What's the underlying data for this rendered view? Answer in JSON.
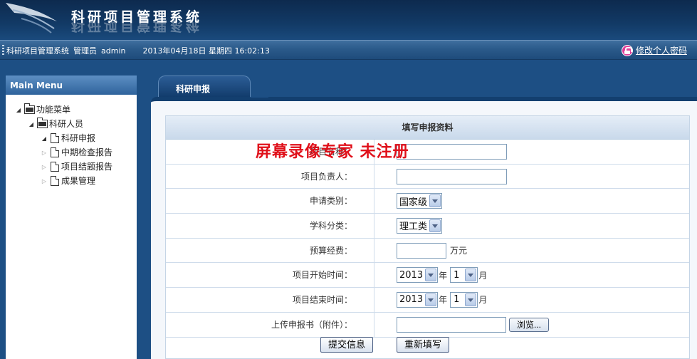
{
  "header": {
    "system_title": "科研项目管理系统"
  },
  "infobar": {
    "system_name": "科研项目管理系统",
    "role": "管理员",
    "username": "admin",
    "datetime": "2013年04月18日 星期四 16:02:13",
    "change_password": "修改个人密码"
  },
  "menu": {
    "title": "Main Menu",
    "root": "功能菜单",
    "group": "科研人员",
    "items": [
      {
        "label": "科研申报"
      },
      {
        "label": "中期检查报告"
      },
      {
        "label": "项目结题报告"
      },
      {
        "label": "成果管理"
      }
    ]
  },
  "tab": {
    "label": "科研申报"
  },
  "form": {
    "title": "填写申报资料",
    "fields": [
      {
        "label": "项目名称："
      },
      {
        "label": "项目负责人："
      },
      {
        "label": "申请类别：",
        "value": "国家级"
      },
      {
        "label": "学科分类：",
        "value": "理工类"
      },
      {
        "label": "预算经费：",
        "unit": "万元"
      },
      {
        "label": "项目开始时间：",
        "year": "2013",
        "year_unit": "年",
        "month": "1",
        "month_unit": "月"
      },
      {
        "label": "项目结束时间：",
        "year": "2013",
        "year_unit": "年",
        "month": "1",
        "month_unit": "月"
      },
      {
        "label": "上传申报书（附件）：",
        "browse": "浏览..."
      }
    ],
    "submit": "提交信息",
    "reset": "重新填写"
  },
  "watermark": "屏幕录像专家  未注册",
  "colors": {
    "header_bg": "#123a66",
    "watermark": "#e0101a",
    "pwd_icon": "#e0409a"
  }
}
